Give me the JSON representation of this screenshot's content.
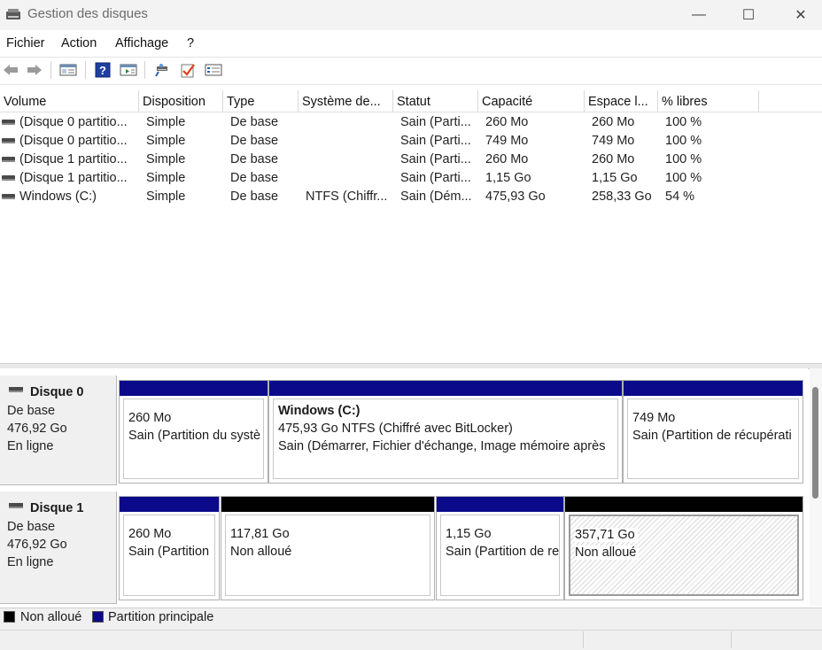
{
  "window": {
    "title": "Gestion des disques",
    "controls": {
      "minimize": "—",
      "maximize": "☐",
      "close": "✕"
    }
  },
  "menu": [
    "Fichier",
    "Action",
    "Affichage",
    "?"
  ],
  "toolbar": [
    "back-icon",
    "forward-icon",
    "console-tree-icon",
    "help-icon",
    "action-pane-icon",
    "rescan-icon",
    "check-icon",
    "properties-icon"
  ],
  "volume_list": {
    "columns": [
      "Volume",
      "Disposition",
      "Type",
      "Système de...",
      "Statut",
      "Capacité",
      "Espace l...",
      "% libres"
    ],
    "rows": [
      [
        "(Disque 0 partitio...",
        "Simple",
        "De base",
        "",
        "Sain (Parti...",
        "260 Mo",
        "260 Mo",
        "100 %"
      ],
      [
        "(Disque 0 partitio...",
        "Simple",
        "De base",
        "",
        "Sain (Parti...",
        "749 Mo",
        "749 Mo",
        "100 %"
      ],
      [
        "(Disque 1 partitio...",
        "Simple",
        "De base",
        "",
        "Sain (Parti...",
        "260 Mo",
        "260 Mo",
        "100 %"
      ],
      [
        "(Disque 1 partitio...",
        "Simple",
        "De base",
        "",
        "Sain (Parti...",
        "1,15 Go",
        "1,15 Go",
        "100 %"
      ],
      [
        "Windows (C:)",
        "Simple",
        "De base",
        "NTFS (Chiffr...",
        "Sain (Dém...",
        "475,93 Go",
        "258,33 Go",
        "54 %"
      ]
    ]
  },
  "disks": [
    {
      "name": "Disque 0",
      "type": "De base",
      "size": "476,92 Go",
      "state": "En ligne",
      "partitions": [
        {
          "title": "",
          "line1": "260 Mo",
          "line2": "Sain (Partition du systè",
          "bar": "#0a0a8a",
          "unallocated": false
        },
        {
          "title": "Windows  (C:)",
          "line1": "475,93 Go NTFS (Chiffré avec BitLocker)",
          "line2": "Sain (Démarrer, Fichier d'échange, Image mémoire après",
          "bar": "#0a0a8a",
          "unallocated": false
        },
        {
          "title": "",
          "line1": "749 Mo",
          "line2": "Sain (Partition de récupérati",
          "bar": "#0a0a8a",
          "unallocated": false
        }
      ]
    },
    {
      "name": "Disque 1",
      "type": "De base",
      "size": "476,92 Go",
      "state": "En ligne",
      "partitions": [
        {
          "title": "",
          "line1": "260 Mo",
          "line2": "Sain (Partition",
          "bar": "#0a0a8a",
          "unallocated": false
        },
        {
          "title": "",
          "line1": "117,81 Go",
          "line2": "Non alloué",
          "bar": "#000000",
          "unallocated": true
        },
        {
          "title": "",
          "line1": "1,15 Go",
          "line2": "Sain (Partition de re",
          "bar": "#0a0a8a",
          "unallocated": false
        },
        {
          "title": "",
          "line1": "357,71 Go",
          "line2": "Non alloué",
          "bar": "#000000",
          "unallocated": true
        }
      ]
    }
  ],
  "legend": [
    {
      "label": "Non alloué",
      "color": "#000000"
    },
    {
      "label": "Partition principale",
      "color": "#0a0a8a"
    }
  ]
}
